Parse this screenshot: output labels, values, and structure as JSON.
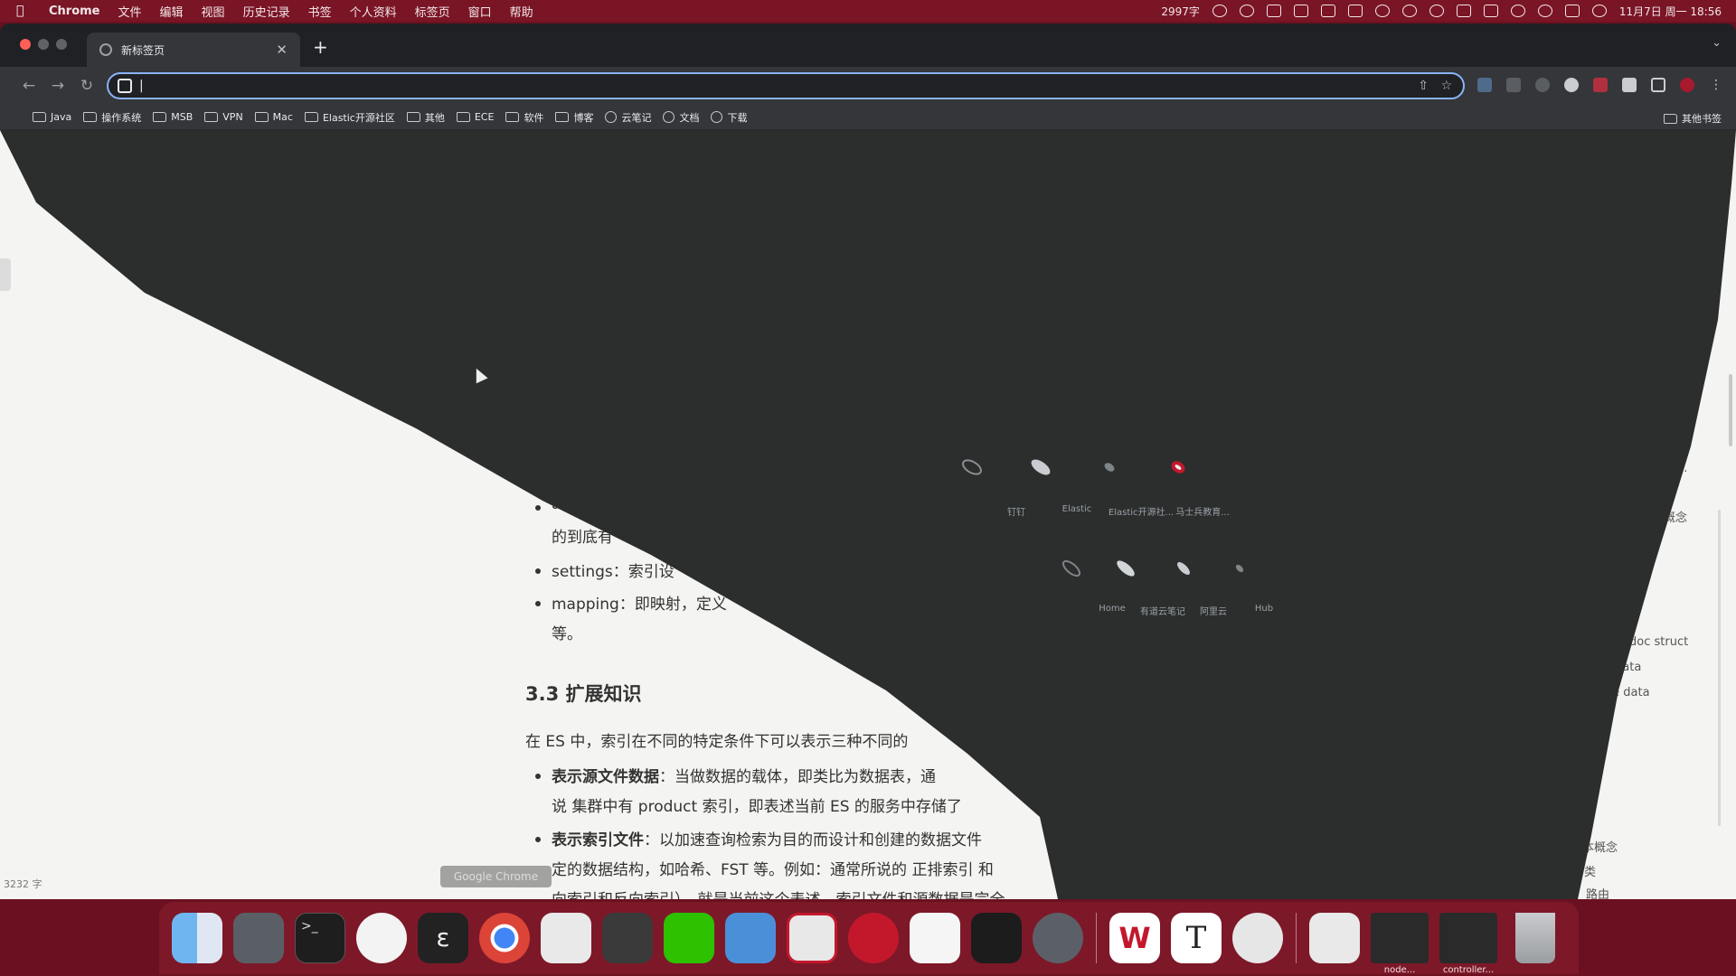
{
  "menubar": {
    "app": "Chrome",
    "items": [
      "文件",
      "编辑",
      "视图",
      "历史记录",
      "书签",
      "个人资料",
      "标签页",
      "窗口",
      "帮助"
    ],
    "word_count": "2997字",
    "datetime": "11月7日 周一  18:56"
  },
  "tab": {
    "title": "新标签页",
    "close": "✕",
    "new_tab": "+"
  },
  "toolbar": {
    "address_value": "|"
  },
  "bookmarks": {
    "items": [
      "Java",
      "操作系统",
      "MSB",
      "VPN",
      "Mac",
      "Elastic开源社区",
      "其他",
      "ECE",
      "软件",
      "博客",
      "云笔记",
      "文档",
      "下载"
    ],
    "other": "其他书签"
  },
  "newtab_shortcuts": {
    "row1": [
      "钉钉",
      "Elastic",
      "Elastic开源社...",
      "马士兵教育..."
    ],
    "row2": [
      "Home",
      "有道云笔记",
      "阿里云",
      "Hub"
    ]
  },
  "doc": {
    "bullet_a_fragment": "a",
    "bullet_a_line2": "的到底有",
    "settings_line": "settings：索引设",
    "mapping_line": "mapping：即映射，定义",
    "mapping_line2": "等。",
    "section_heading": "3.3 扩展知识",
    "intro": "在 ES 中，索引在不同的特定条件下可以表示三种不同的",
    "b1_bold": "表示源文件数据",
    "b1_text": "：当做数据的载体，即类比为数据表，通",
    "b1_line2": "说 集群中有 product 索引，即表述当前 ES 的服务中存储了",
    "b2_bold": "表示索引文件",
    "b2_text": "：以加速查询检索为目的而设计和创建的数据文件",
    "b2_line2": "定的数据结构，如哈希、FST 等。例如：通常所说的 正排索引 和",
    "b2_line3": "向索引和反向索引）。就是当前这个表述，索引文件和源数据是完全",
    "status": "3232 字"
  },
  "side_outline": [
    "ea...",
    "概念",
    "doc struct",
    "data",
    "ce data",
    "本概念",
    "类",
    "路由"
  ],
  "dock": {
    "tooltip": "Google Chrome",
    "labels": {
      "node": "node...",
      "controller": "controller..."
    }
  },
  "colors": {
    "accent": "#8ab4f8",
    "menubar": "#7a1526",
    "dock": "#7d1828"
  }
}
